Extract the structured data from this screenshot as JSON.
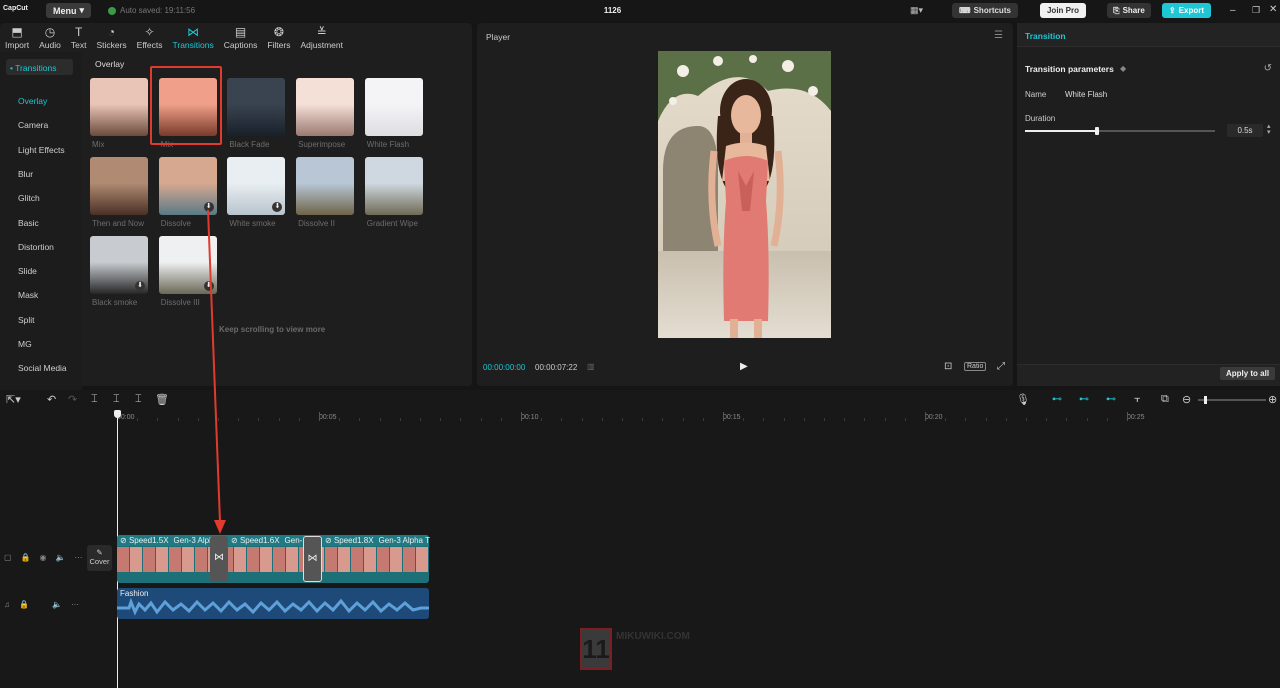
{
  "app": {
    "logo": "CapCut",
    "menu_label": "Menu",
    "autosave": "Auto saved: 19:11:56",
    "project_title": "1126"
  },
  "topbar": {
    "shortcuts": "Shortcuts",
    "join_pro": "Join Pro",
    "share": "Share",
    "export": "Export"
  },
  "toolbar": [
    {
      "label": "Import",
      "icon": "import-icon"
    },
    {
      "label": "Audio",
      "icon": "audio-icon"
    },
    {
      "label": "Text",
      "icon": "text-icon"
    },
    {
      "label": "Stickers",
      "icon": "stickers-icon"
    },
    {
      "label": "Effects",
      "icon": "effects-icon"
    },
    {
      "label": "Transitions",
      "icon": "transitions-icon",
      "active": true
    },
    {
      "label": "Captions",
      "icon": "captions-icon"
    },
    {
      "label": "Filters",
      "icon": "filters-icon"
    },
    {
      "label": "Adjustment",
      "icon": "adjustment-icon"
    }
  ],
  "sidebar": {
    "header": "• Transitions",
    "items": [
      "Overlay",
      "Camera",
      "Light Effects",
      "Blur",
      "Glitch",
      "Basic",
      "Distortion",
      "Slide",
      "Mask",
      "Split",
      "MG",
      "Social Media"
    ],
    "active": "Overlay"
  },
  "library": {
    "section_title": "Overlay",
    "items": [
      {
        "label": "Mix"
      },
      {
        "label": "Mix",
        "selected": true
      },
      {
        "label": "Black Fade"
      },
      {
        "label": "Superimpose"
      },
      {
        "label": "White Flash"
      },
      {
        "label": "Then and Now"
      },
      {
        "label": "Dissolve",
        "download": true
      },
      {
        "label": "White smoke",
        "download": true
      },
      {
        "label": "Dissolve II"
      },
      {
        "label": "Gradient Wipe"
      },
      {
        "label": "Black smoke",
        "download": true
      },
      {
        "label": "Dissolve III",
        "download": true
      }
    ],
    "scroll_hint": "Keep scrolling to view more"
  },
  "player": {
    "title": "Player",
    "current_time": "00:00:00:00",
    "total_time": "00:00:07:22",
    "ratio_label": "Ratio"
  },
  "inspector": {
    "tab": "Transition",
    "section": "Transition parameters",
    "name_label": "Name",
    "name_value": "White Flash",
    "duration_label": "Duration",
    "duration_value": "0.5s",
    "duration_level": 0.05,
    "apply_all": "Apply to all"
  },
  "timeline": {
    "ruler": [
      "00:00",
      "00:05",
      "00:10",
      "00:15",
      "00:20",
      "00:25"
    ],
    "cover_label": "Cover",
    "clips": [
      {
        "speed": "Speed1.5X",
        "name": "Gen-3 Alph"
      },
      {
        "speed": "Speed1.6X",
        "name": "Gen-"
      },
      {
        "speed": "Speed1.8X",
        "name": "Gen-3 Alpha T"
      }
    ],
    "audio_label": "Fashion"
  },
  "watermark": {
    "text": "11",
    "site": "MIKUWIKI.COM"
  },
  "colors": {
    "accent": "#1fc6d4",
    "highlight": "#e23a2e",
    "export_bg": "#1fc6d4",
    "clip_teal": "#1d6f78",
    "audio_blue": "#1d4a78"
  }
}
